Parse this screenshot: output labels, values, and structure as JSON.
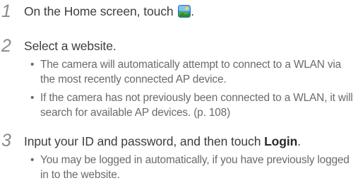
{
  "steps": [
    {
      "number": "1",
      "text_before_icon": "On the Home screen, touch",
      "text_after_icon": ".",
      "icon": "landscape-photo-app-icon"
    },
    {
      "number": "2",
      "text": "Select a website.",
      "bullets": [
        "The camera will automatically attempt to connect to a WLAN via the most recently connected AP device.",
        "If the camera has not previously been connected to a WLAN, it will search for available AP devices. (p. 108)"
      ]
    },
    {
      "number": "3",
      "text_before_bold": "Input your ID and password, and then touch ",
      "bold_text": "Login",
      "text_after_bold": ".",
      "bullets": [
        "You may be logged in automatically, if you have previously logged in to the website."
      ]
    }
  ],
  "bullet_glyph": "•",
  "colors": {
    "step_number": "#8a8a8a",
    "step_text": "#3d3d3d",
    "bullet_text": "#6a6a6a"
  }
}
